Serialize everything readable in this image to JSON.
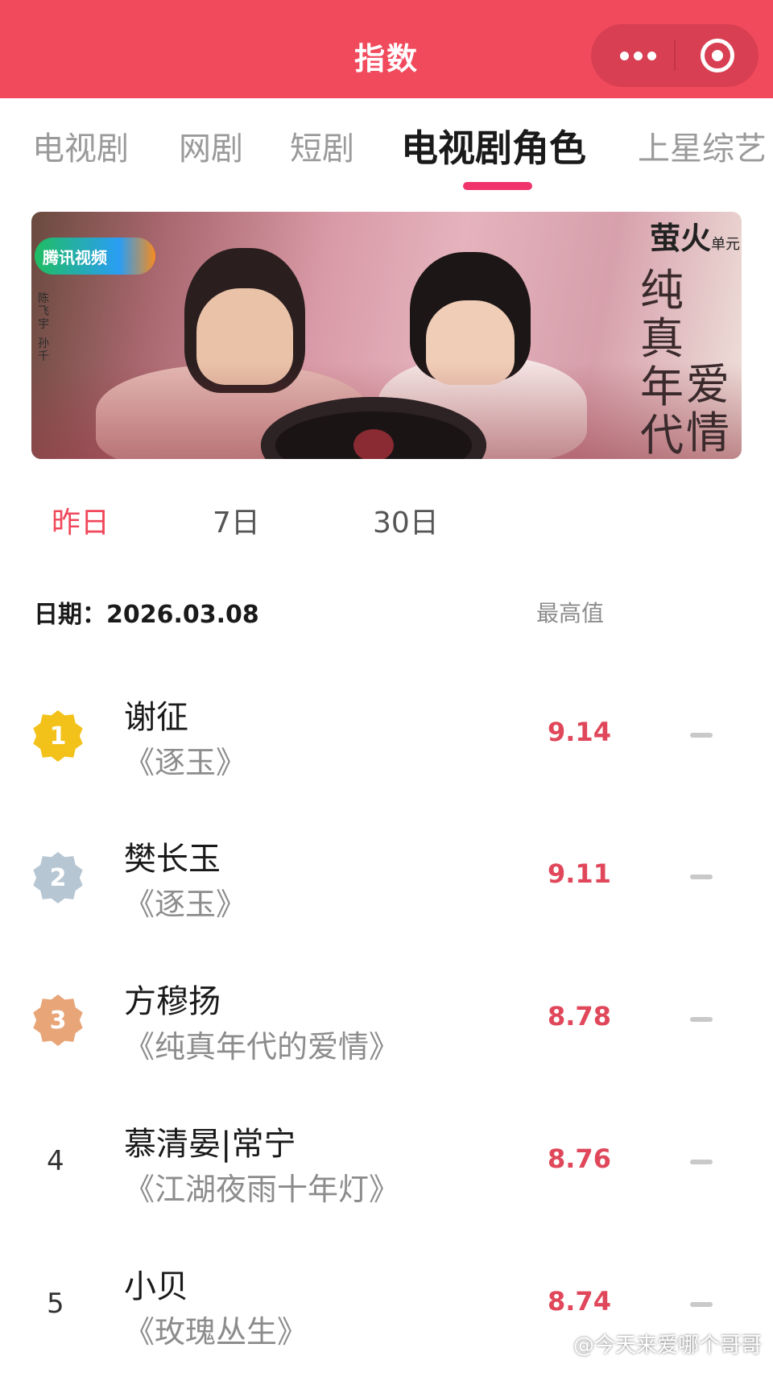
{
  "header": {
    "title": "指数",
    "menu_icon": "more-dots-icon",
    "close_icon": "target-circle-icon",
    "color": "#f14a5d"
  },
  "tabs": [
    {
      "label": "电视剧",
      "active": false
    },
    {
      "label": "网剧",
      "active": false
    },
    {
      "label": "短剧",
      "active": false
    },
    {
      "label": "电视剧角色",
      "active": true
    },
    {
      "label": "上星综艺",
      "active": false
    }
  ],
  "banner": {
    "platform": "腾讯视频",
    "cast": [
      "陈飞宇",
      "孙千"
    ],
    "brand": "萤火",
    "brand_sub": "单元",
    "title_line1": "纯真年代",
    "title_line2": "爱情"
  },
  "period_tabs": [
    {
      "label": "昨日",
      "active": true
    },
    {
      "label": "7日",
      "active": false
    },
    {
      "label": "30日",
      "active": false
    }
  ],
  "date": {
    "label": "日期：",
    "value": "2026.03.08",
    "column_label": "最高值"
  },
  "ranking": [
    {
      "rank": "1",
      "medal": "gold",
      "name": "谢征",
      "drama": "《逐玉》",
      "score": "9.14",
      "trend": "flat-dash-icon"
    },
    {
      "rank": "2",
      "medal": "silver",
      "name": "樊长玉",
      "drama": "《逐玉》",
      "score": "9.11",
      "trend": "flat-dash-icon"
    },
    {
      "rank": "3",
      "medal": "bronze",
      "name": "方穆扬",
      "drama": "《纯真年代的爱情》",
      "score": "8.78",
      "trend": "flat-dash-icon"
    },
    {
      "rank": "4",
      "medal": "",
      "name": "慕清晏|常宁",
      "drama": "《江湖夜雨十年灯》",
      "score": "8.76",
      "trend": "flat-dash-icon"
    },
    {
      "rank": "5",
      "medal": "",
      "name": "小贝",
      "drama": "《玫瑰丛生》",
      "score": "8.74",
      "trend": "flat-dash-icon"
    }
  ],
  "watermark": "@今天来爱哪个哥哥",
  "accent": "#f0485b"
}
